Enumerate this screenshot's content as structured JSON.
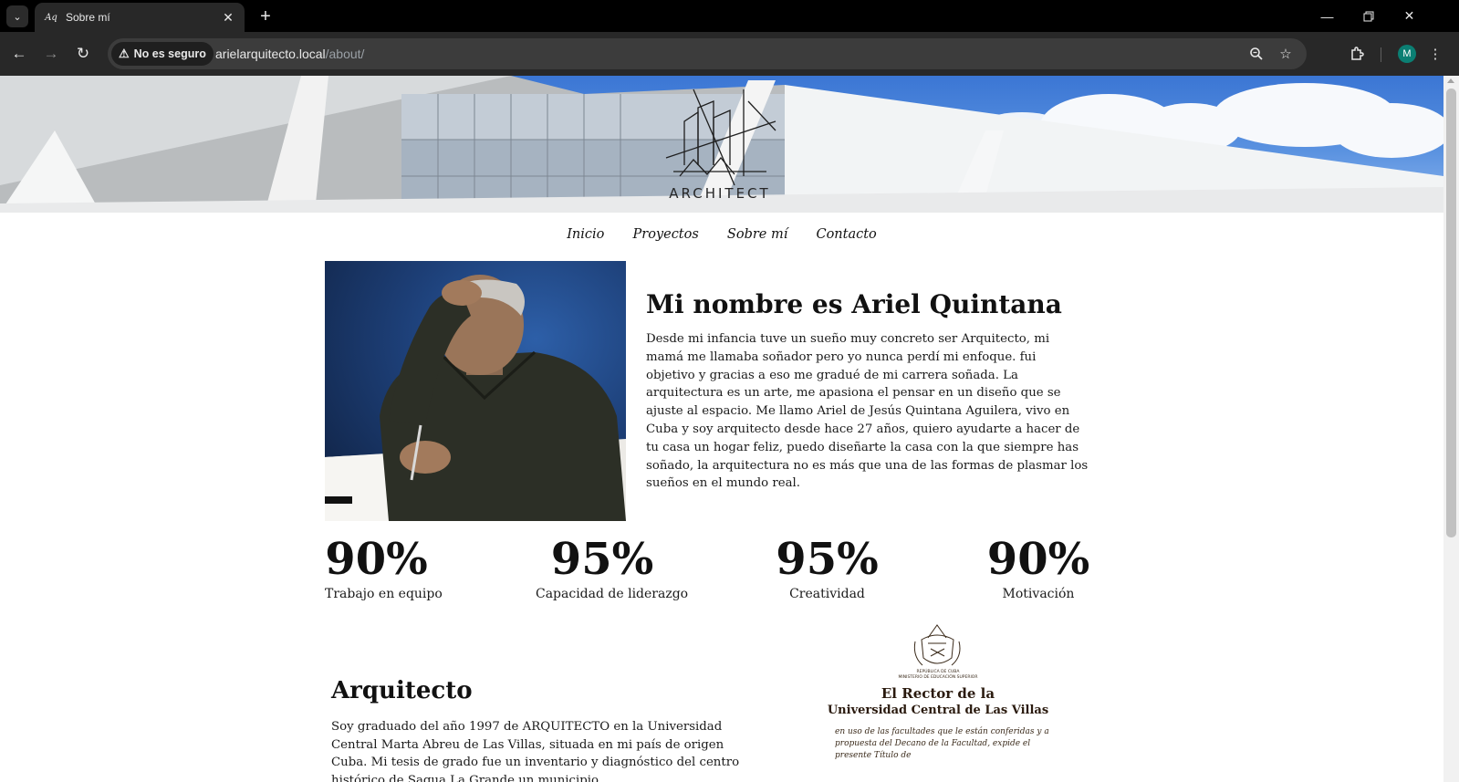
{
  "browser": {
    "tab_title": "Sobre mí",
    "security_label": "No es seguro",
    "url_host": "arielarquitecto.local",
    "url_path": "/about/",
    "profile_initial": "M"
  },
  "header": {
    "logo_text": "ARCHITECT"
  },
  "nav": {
    "items": [
      "Inicio",
      "Proyectos",
      "Sobre mí",
      "Contacto"
    ]
  },
  "intro": {
    "title": "Mi nombre es Ariel Quintana",
    "text": "Desde mi infancia tuve un sueño muy concreto ser Arquitecto, mi mamá me llamaba soñador pero yo nunca perdí mi enfoque. fui objetivo y gracias a eso me gradué de mi carrera soñada. La arquitectura es un arte, me apasiona el pensar en un diseño que se ajuste al espacio. Me llamo Ariel de Jesús Quintana Aguilera, vivo en Cuba y soy arquitecto desde hace 27 años, quiero ayudarte a hacer de tu casa un hogar feliz, puedo diseñarte la casa con la que siempre has soñado, la arquitectura no es más que una de las formas de plasmar los sueños en el mundo real."
  },
  "stats": [
    {
      "value": "90%",
      "label": "Trabajo en equipo"
    },
    {
      "value": "95%",
      "label": "Capacidad de liderazgo"
    },
    {
      "value": "95%",
      "label": "Creatividad"
    },
    {
      "value": "90%",
      "label": "Motivación"
    }
  ],
  "education": {
    "title": "Arquitecto",
    "text": "Soy graduado del año 1997 de ARQUITECTO en la Universidad Central Marta Abreu de Las Villas, situada en mi país de origen Cuba. Mi tesis de grado fue un inventario y diagnóstico del centro histórico de Sagua La Grande un municipio",
    "diploma_lines": [
      "REPÚBLICA DE CUBA",
      "MINISTERIO DE EDUCACIÓN SUPERIOR",
      "El Rector de la",
      "Universidad Central de Las Villas",
      "en uso de las facultades que le están conferidas y a",
      "propuesta del Decano de la Facultad, expide el",
      "presente Título de"
    ]
  }
}
